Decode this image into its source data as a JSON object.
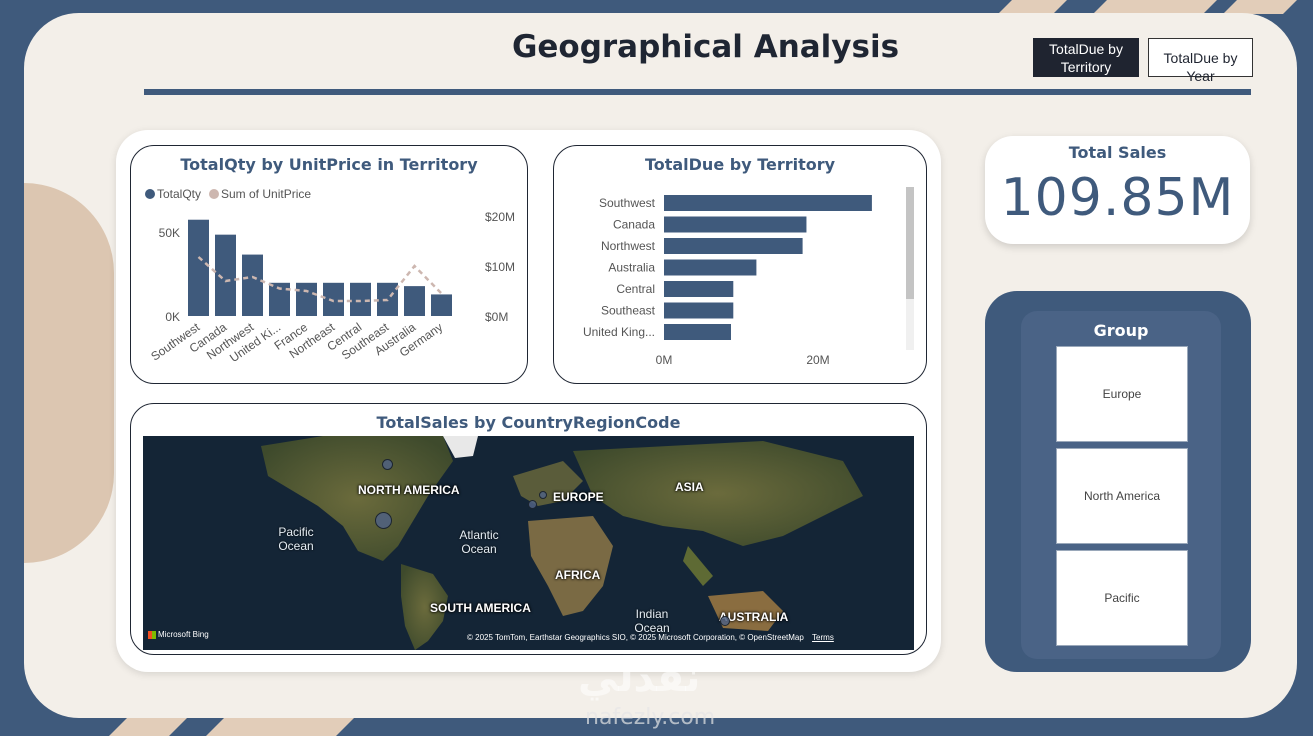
{
  "page": {
    "title": "Geographical Analysis",
    "nav": {
      "territory_button": "TotalDue by Territory",
      "year_button": "TotalDue by Year"
    }
  },
  "colors": {
    "navy": "#3f5a7c",
    "beige": "#f3efe9",
    "accent_tan": "#e2cdb9",
    "line_dash": "#cdb7b0",
    "dark_button": "#1f2430"
  },
  "qty_chart": {
    "title": "TotalQty by UnitPrice in Territory",
    "legend": [
      "TotalQty",
      "Sum of UnitPrice"
    ],
    "left_ticks": [
      "50K",
      "0K"
    ],
    "right_ticks": [
      "$20M",
      "$10M",
      "$0M"
    ]
  },
  "due_chart": {
    "title": "TotalDue by Territory",
    "x_ticks": [
      "0M",
      "20M"
    ]
  },
  "map_card": {
    "title": "TotalSales by CountryRegionCode",
    "labels": {
      "north_america": "NORTH AMERICA",
      "europe": "EUROPE",
      "asia": "ASIA",
      "africa": "AFRICA",
      "south_america": "SOUTH AMERICA",
      "australia": "AUSTRALIA",
      "pacific_ocean": "Pacific Ocean",
      "atlantic_ocean": "Atlantic Ocean",
      "indian_ocean": "Indian Ocean"
    },
    "attribution": "© 2025 TomTom, Earthstar Geographics SIO, © 2025 Microsoft Corporation, © OpenStreetMap",
    "terms": "Terms",
    "brand": "Microsoft Bing"
  },
  "kpi": {
    "label": "Total Sales",
    "value": "109.85M"
  },
  "group_slicer": {
    "title": "Group",
    "options": [
      "Europe",
      "North America",
      "Pacific"
    ]
  },
  "chart_data": [
    {
      "type": "bar",
      "title": "TotalQty by UnitPrice in Territory",
      "categories": [
        "Southwest",
        "Canada",
        "Northwest",
        "United Ki...",
        "France",
        "Northeast",
        "Central",
        "Southeast",
        "Australia",
        "Germany"
      ],
      "series": [
        {
          "name": "TotalQty",
          "type": "bar",
          "axis": "left",
          "values": [
            58000,
            49000,
            37000,
            20000,
            20000,
            20000,
            20000,
            20000,
            18000,
            13000
          ]
        },
        {
          "name": "Sum of UnitPrice",
          "type": "line",
          "axis": "right",
          "style": "dashed",
          "values": [
            11800000,
            7000000,
            7800000,
            5500000,
            5000000,
            3000000,
            3000000,
            3200000,
            10000000,
            4500000
          ]
        }
      ],
      "ylim_left": [
        0,
        60000
      ],
      "ylim_right": [
        0,
        20000000
      ],
      "legend_position": "top-left"
    },
    {
      "type": "bar",
      "orientation": "horizontal",
      "title": "TotalDue by Territory",
      "categories": [
        "Southwest",
        "Canada",
        "Northwest",
        "Australia",
        "Central",
        "Southeast",
        "United King..."
      ],
      "values": [
        27000000,
        18500000,
        18000000,
        12000000,
        9000000,
        9000000,
        8700000
      ],
      "xlim": [
        0,
        30000000
      ]
    }
  ]
}
